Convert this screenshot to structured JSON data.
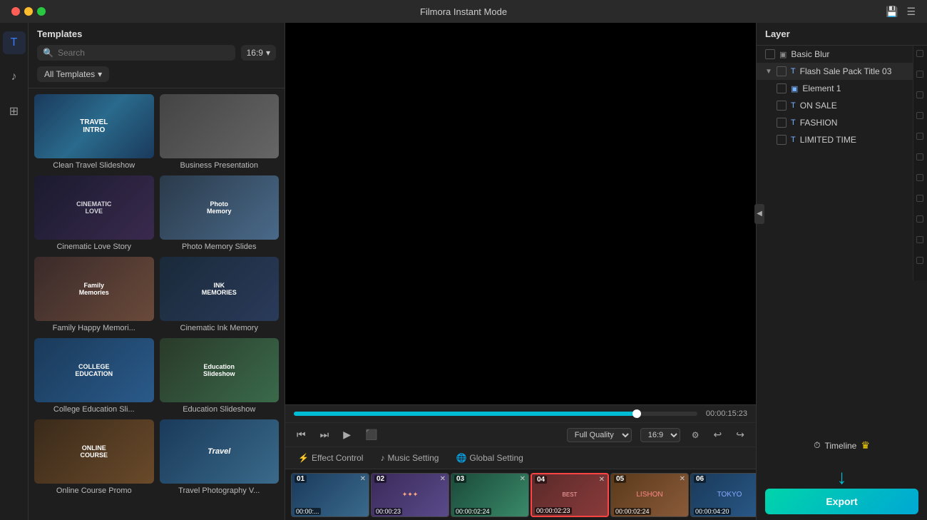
{
  "app": {
    "title": "Filmora Instant Mode",
    "traffic_lights": [
      "red",
      "yellow",
      "green"
    ]
  },
  "sidebar": {
    "icons": [
      {
        "name": "text-icon",
        "symbol": "T",
        "active": true
      },
      {
        "name": "music-icon",
        "symbol": "♪",
        "active": false
      },
      {
        "name": "effect-icon",
        "symbol": "✨",
        "active": false
      }
    ]
  },
  "templates_panel": {
    "title": "Templates",
    "search_placeholder": "Search",
    "ratio": "16 : 9",
    "filter_label": "All Templates",
    "cards": [
      {
        "id": "card-1",
        "label": "Clean Travel Slideshow",
        "thumb_class": "thumb-travel",
        "thumb_text": "TRAVEL INTRO"
      },
      {
        "id": "card-2",
        "label": "Business Presentation",
        "thumb_class": "thumb-business",
        "thumb_text": ""
      },
      {
        "id": "card-3",
        "label": "Cinematic Love Story",
        "thumb_class": "thumb-cinematic",
        "thumb_text": "CINEMATIC LOVE"
      },
      {
        "id": "card-4",
        "label": "Photo Memory Slides",
        "thumb_class": "thumb-photo",
        "thumb_text": "Photo Memory"
      },
      {
        "id": "card-5",
        "label": "Family Happy Memori...",
        "thumb_class": "thumb-family",
        "thumb_text": "Family Memories"
      },
      {
        "id": "card-6",
        "label": "Cinematic Ink Memory",
        "thumb_class": "thumb-ink",
        "thumb_text": "INK MEMORIES"
      },
      {
        "id": "card-7",
        "label": "College Education Sli...",
        "thumb_class": "thumb-college",
        "thumb_text": "COLLEGE EDUCATION"
      },
      {
        "id": "card-8",
        "label": "Education Slideshow",
        "thumb_class": "thumb-education",
        "thumb_text": "Education Slideshow"
      },
      {
        "id": "card-9",
        "label": "Online Course Promo",
        "thumb_class": "thumb-online",
        "thumb_text": "ONLINE COURSE"
      },
      {
        "id": "card-10",
        "label": "Travel Photography V...",
        "thumb_class": "thumb-travelphoto",
        "thumb_text": "Travel"
      }
    ]
  },
  "playback": {
    "current_time": "00:00:15:23",
    "progress_percent": 85,
    "quality": "Full Quality",
    "ratio": "16:9"
  },
  "tabs": [
    {
      "id": "effect-control",
      "label": "Effect Control",
      "icon": "⚡"
    },
    {
      "id": "music-setting",
      "label": "Music Setting",
      "icon": "♪"
    },
    {
      "id": "global-setting",
      "label": "Global Setting",
      "icon": "🌐"
    }
  ],
  "timeline_clips": [
    {
      "num": "01",
      "duration": "00:00:...",
      "color_class": "clip-01",
      "text": ""
    },
    {
      "num": "02",
      "duration": "00:00:23",
      "color_class": "clip-02",
      "text": ""
    },
    {
      "num": "03",
      "duration": "00:00:02:24",
      "color_class": "clip-03",
      "text": ""
    },
    {
      "num": "04",
      "duration": "00:00:02:23",
      "color_class": "clip-04 clip-active",
      "text": ""
    },
    {
      "num": "05",
      "duration": "00:00:02:24",
      "color_class": "clip-05",
      "text": ""
    },
    {
      "num": "06",
      "duration": "00:00:04:20",
      "color_class": "clip-06",
      "text": ""
    }
  ],
  "layer_panel": {
    "title": "Layer",
    "items": [
      {
        "id": "basic-blur",
        "name": "Basic Blur",
        "indent": 0,
        "icon": "▣",
        "has_arrow": false
      },
      {
        "id": "flash-sale",
        "name": "Flash Sale Pack Title 03",
        "indent": 0,
        "icon": "T",
        "has_arrow": true,
        "expanded": true
      },
      {
        "id": "element-1",
        "name": "Element 1",
        "indent": 1,
        "icon": "▣",
        "has_arrow": false
      },
      {
        "id": "on-sale",
        "name": "ON SALE",
        "indent": 1,
        "icon": "T",
        "has_arrow": false
      },
      {
        "id": "fashion",
        "name": "FASHION",
        "indent": 1,
        "icon": "T",
        "has_arrow": false
      },
      {
        "id": "limited-time",
        "name": "LIMITED TIME",
        "indent": 1,
        "icon": "T",
        "has_arrow": false
      }
    ]
  },
  "timeline_right": {
    "label": "Timeline",
    "export_label": "Export"
  }
}
